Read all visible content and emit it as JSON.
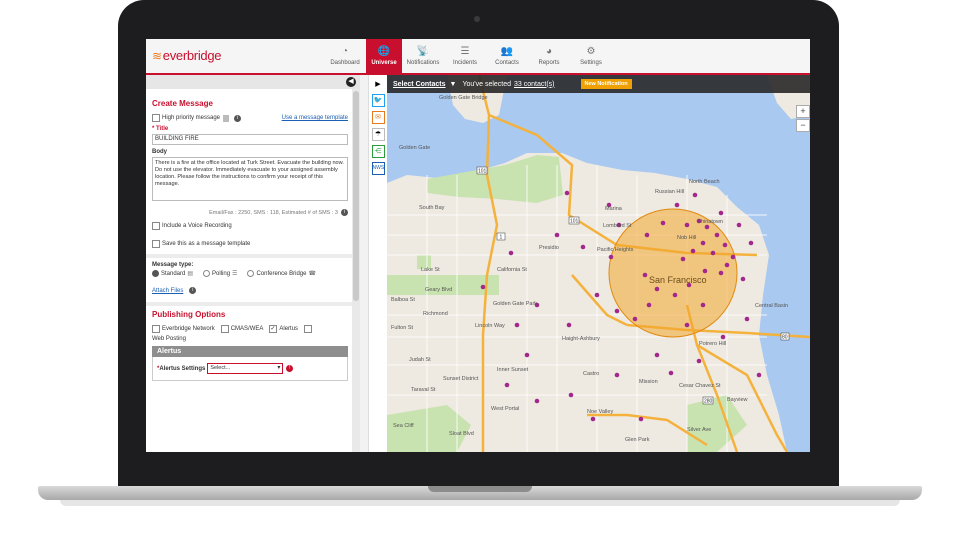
{
  "nav": {
    "logo": "everbridge",
    "items": [
      {
        "label": "Dashboard",
        "icon": "dashboard-icon",
        "glyph": "◔"
      },
      {
        "label": "Universe",
        "icon": "globe-icon",
        "glyph": "🌐",
        "active": true
      },
      {
        "label": "Notifications",
        "icon": "notifications-icon",
        "glyph": "📡"
      },
      {
        "label": "Incidents",
        "icon": "incidents-icon",
        "glyph": "☰"
      },
      {
        "label": "Contacts",
        "icon": "contacts-icon",
        "glyph": "👥"
      },
      {
        "label": "Reports",
        "icon": "reports-icon",
        "glyph": "◕"
      },
      {
        "label": "Settings",
        "icon": "gear-icon",
        "glyph": "⚙"
      }
    ]
  },
  "create_message": {
    "title": "Create Message",
    "high_priority_label": "High priority message",
    "use_template_link": "Use a message template",
    "title_label": "* Title",
    "title_value": "BUILDING FIRE",
    "body_label": "Body",
    "body_value": "There is a fire at the office located at Turk Street.  Evacuate the building now. Do not use the elevator.  Immediately evacuate to your assigned assembly location.  Please follow the instructions to confirm your receipt of this message.",
    "counter": "Email/Fax : 2250, SMS : 118, Estimated # of SMS : 3",
    "voice_recording_label": "Include a Voice Recording",
    "save_template_label": "Save this as a message template",
    "message_type_label": "Message type:",
    "message_types": [
      "Standard",
      "Polling",
      "Conference Bridge"
    ],
    "attach_files_link": "Attach Files"
  },
  "publishing": {
    "title": "Publishing Options",
    "options": [
      {
        "label": "Everbridge Network",
        "checked": false
      },
      {
        "label": "CMAS/WEA",
        "checked": false
      },
      {
        "label": "Alertus",
        "checked": true
      },
      {
        "label": "Web Posting",
        "checked": false
      }
    ],
    "alertus_header": "Alertus",
    "alertus_settings_label": "*Alertus Settings",
    "alertus_select_value": "Select..."
  },
  "mapbar": {
    "select_contacts": "Select Contacts",
    "selected_prefix": "You've selected",
    "selected_count": "33 contact(s)",
    "new_notification": "New Notification"
  },
  "map": {
    "labels": {
      "golden_gate_bridge": "Golden Gate Bridge",
      "golden_gate": "Golden Gate",
      "south_bay": "South Bay",
      "presidio": "Presidio",
      "marina": "Marina",
      "pacific_heights": "Pacific Heights",
      "san_francisco": "San Francisco",
      "golden_gate_park": "Golden Gate Park",
      "sunset_district": "Sunset District",
      "west_portal": "West Portal",
      "glen_park": "Glen Park",
      "noe_valley": "Noe Valley",
      "mission": "Mission",
      "castro": "Castro",
      "richmond": "Richmond",
      "inner_sunset": "Inner Sunset",
      "potrero_hill": "Potrero Hill",
      "bayview": "Bayview",
      "lincoln_way": "Lincoln Way",
      "geary_blvd": "Geary Blvd",
      "california_st": "California St",
      "lombard_st": "Lombard St",
      "cesar_chavez_st": "Cesar Chavez St",
      "central_basin": "Central Basin",
      "route_1": "1",
      "route_101": "101",
      "route_80": "80",
      "route_280": "280",
      "sloat_blvd": "Sloat Blvd",
      "silver_ave": "Silver Ave",
      "north_beach": "North Beach",
      "chinatown": "Chinatown",
      "nob_hill": "Nob Hill",
      "russian_hill": "Russian Hill",
      "haight_ashbury": "Haight-Ashbury",
      "sea_cliff": "Sea Cliff",
      "lake_st": "Lake St",
      "balboa_st": "Balboa St",
      "fulton_st": "Fulton St",
      "judah_st": "Judah St",
      "taraval_st": "Taraval St"
    },
    "colors": {
      "water": "#a9c9f0",
      "land": "#eeeae2",
      "park": "#c9e3b0",
      "highway": "#f4b23d",
      "radius": "#f3a52b",
      "contact_dot": "#a3288c"
    }
  }
}
